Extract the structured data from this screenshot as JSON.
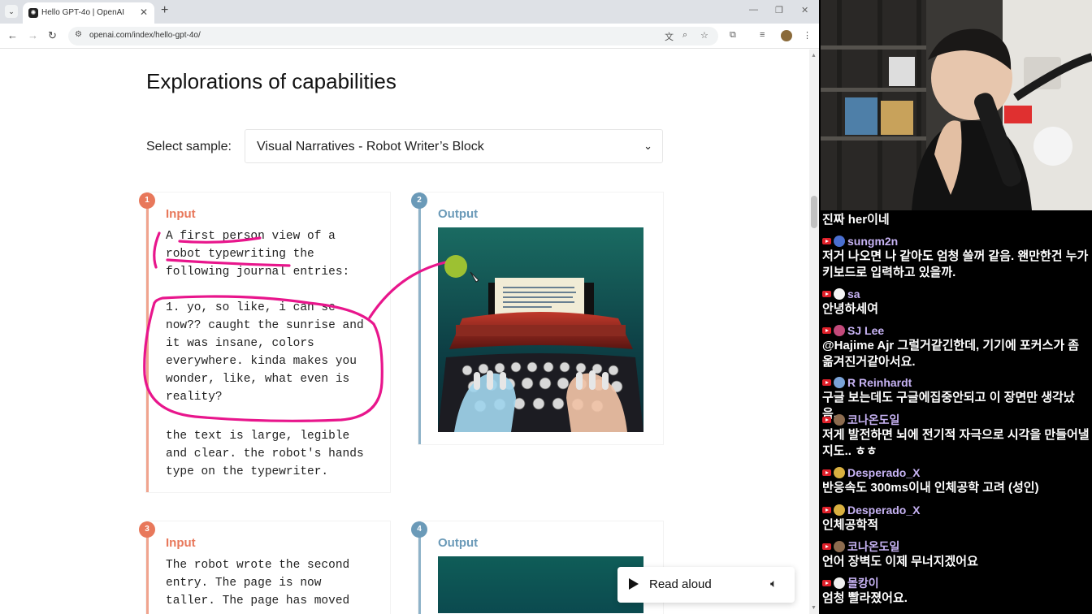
{
  "browser": {
    "tab_title": "Hello GPT-4o | OpenAI",
    "url": "openai.com/index/hello-gpt-4o/"
  },
  "page": {
    "heading": "Explorations of capabilities",
    "select_label": "Select sample:",
    "select_value": "Visual Narratives - Robot Writer’s Block",
    "cards": [
      {
        "number": "1",
        "label": "Input",
        "p1": "A first person view of a robot typewriting the following journal entries:",
        "p2": "1. yo, so like, i can se now?? caught the sunrise and it was insane, colors everywhere. kinda makes you wonder, like, what even is reality?",
        "p3": "the text is large, legible and clear. the robot's hands type on the typewriter."
      },
      {
        "number": "2",
        "label": "Output",
        "paper_text": "yo, so like, i can see now? caught the sunrise and it was insane - colors everywhere. kinda makes you wonder, like, what even is reality?"
      },
      {
        "number": "3",
        "label": "Input",
        "p1": "The robot wrote the second entry. The page is now taller. The page has moved"
      },
      {
        "number": "4",
        "label": "Output"
      }
    ],
    "read_aloud": "Read aloud"
  },
  "chat": {
    "messages": [
      {
        "name": "",
        "text": "진짜 her이네"
      },
      {
        "name": "sungm2n",
        "text": "저거 나오면 나 같아도 엄청 쓸꺼 같음. 왠만한건 누가 키보드로 입력하고 있을까."
      },
      {
        "name": "sa",
        "text": "안녕하세여"
      },
      {
        "name": "SJ Lee",
        "text": "@Hajime Ajr 그럴거같긴한데, 기기에 포커스가 좀 옮겨진거같아서요."
      },
      {
        "name": "R Reinhardt",
        "text": "구글 보는데도 구글에집중안되고 이 장면만 생각났음..."
      },
      {
        "name": "코나온도일",
        "text": "저게 발전하면 뇌에 전기적 자극으로 시각을 만들어낼지도.. ㅎㅎ"
      },
      {
        "name": "Desperado_X",
        "text": "반응속도 300ms이내 인체공학 고려 (성인)"
      },
      {
        "name": "Desperado_X",
        "text": "인체공학적"
      },
      {
        "name": "코나온도일",
        "text": "언어 장벽도 이제 무너지겠어요"
      },
      {
        "name": "몰캉이",
        "text": "엄청 빨라졌어요."
      }
    ]
  },
  "colors": {
    "input_accent": "#e8785b",
    "output_accent": "#6b9ab8",
    "annotation_pink": "#e8168c",
    "chat_name": "#c7b3f4"
  }
}
